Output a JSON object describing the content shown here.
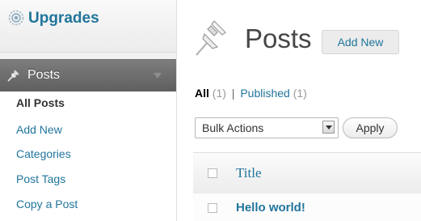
{
  "sidebar": {
    "upgrades": {
      "label": "Upgrades",
      "icon": "upgrades-gear-icon"
    },
    "posts": {
      "label": "Posts",
      "icon": "pushpin-icon",
      "submenu": [
        {
          "label": "All Posts",
          "current": true
        },
        {
          "label": "Add New",
          "current": false
        },
        {
          "label": "Categories",
          "current": false
        },
        {
          "label": "Post Tags",
          "current": false
        },
        {
          "label": "Copy a Post",
          "current": false
        }
      ]
    }
  },
  "main": {
    "title": "Posts",
    "add_new_label": "Add New",
    "filters": {
      "all_label": "All",
      "all_count": "(1)",
      "separator": "|",
      "published_label": "Published",
      "published_count": "(1)"
    },
    "bulk_actions": {
      "selected": "Bulk Actions"
    },
    "apply_label": "Apply",
    "table": {
      "columns": [
        "Title"
      ],
      "rows": [
        {
          "title": "Hello world!"
        }
      ]
    }
  },
  "colors": {
    "link": "#21759b",
    "sidebar_bg": "#f1f1f1",
    "posts_active_bg": "#6d6d6d"
  }
}
